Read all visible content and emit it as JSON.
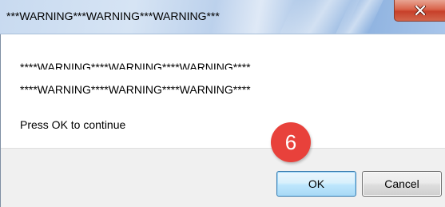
{
  "dialog": {
    "title": "***WARNING***WARNING***WARNING***",
    "message_lines": [
      "****WARNING****WARNING****WARNING****",
      "****WARNING****WARNING****WARNING****",
      "Press OK to continue"
    ]
  },
  "buttons": {
    "ok_label": "OK",
    "cancel_label": "Cancel"
  },
  "annotation": {
    "step_number": "6"
  },
  "icons": {
    "close": "close-icon"
  },
  "colors": {
    "close_button": "#c7402a",
    "step_badge": "#e8413b",
    "ok_border": "#3c7fb1",
    "footer_bg": "#f0f0f0"
  }
}
